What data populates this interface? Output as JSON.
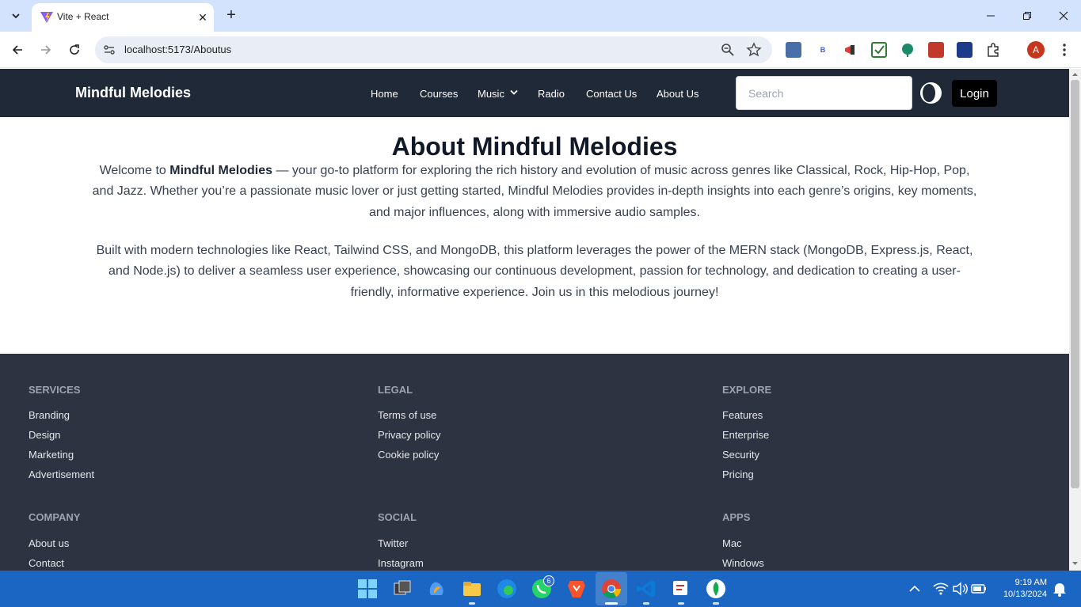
{
  "browser": {
    "tab_title": "Vite + React",
    "url": "localhost:5173/Aboutus",
    "new_tab_symbol": "+",
    "profile_initial": "A"
  },
  "navbar": {
    "brand": "Mindful Melodies",
    "links": [
      "Home",
      "Courses",
      "Music",
      "Radio",
      "Contact Us",
      "About Us"
    ],
    "search_placeholder": "Search",
    "login": "Login"
  },
  "about": {
    "title": "About Mindful Melodies",
    "p1_prefix": "Welcome to ",
    "p1_bold": "Mindful Melodies",
    "p1_rest": " — your go-to platform for exploring the rich history and evolution of music across genres like Classical, Rock, Hip-Hop, Pop, and Jazz. Whether you’re a passionate music lover or just getting started, Mindful Melodies provides in-depth insights into each genre’s origins, key moments, and major influences, along with immersive audio samples.",
    "p2": "Built with modern technologies like React, Tailwind CSS, and MongoDB, this platform leverages the power of the MERN stack (MongoDB, Express.js, React, and Node.js) to deliver a seamless user experience, showcasing our continuous development, passion for technology, and dedication to creating a user-friendly, informative experience. Join us in this melodious journey!"
  },
  "footer": {
    "services": {
      "title": "SERVICES",
      "links": [
        "Branding",
        "Design",
        "Marketing",
        "Advertisement"
      ]
    },
    "legal": {
      "title": "LEGAL",
      "links": [
        "Terms of use",
        "Privacy policy",
        "Cookie policy"
      ]
    },
    "explore": {
      "title": "EXPLORE",
      "links": [
        "Features",
        "Enterprise",
        "Security",
        "Pricing"
      ]
    },
    "company": {
      "title": "COMPANY",
      "links": [
        "About us",
        "Contact"
      ]
    },
    "social": {
      "title": "SOCIAL",
      "links": [
        "Twitter",
        "Instagram"
      ]
    },
    "apps": {
      "title": "APPS",
      "links": [
        "Mac",
        "Windows"
      ]
    }
  },
  "taskbar": {
    "time": "9:19 AM",
    "date": "10/13/2024",
    "whatsapp_badge": "6"
  },
  "colors": {
    "navbar_bg": "#1f2937",
    "footer_bg": "#2d3340",
    "taskbar_bg": "#1a66c2",
    "tabstrip_bg": "#d3e3fd"
  }
}
